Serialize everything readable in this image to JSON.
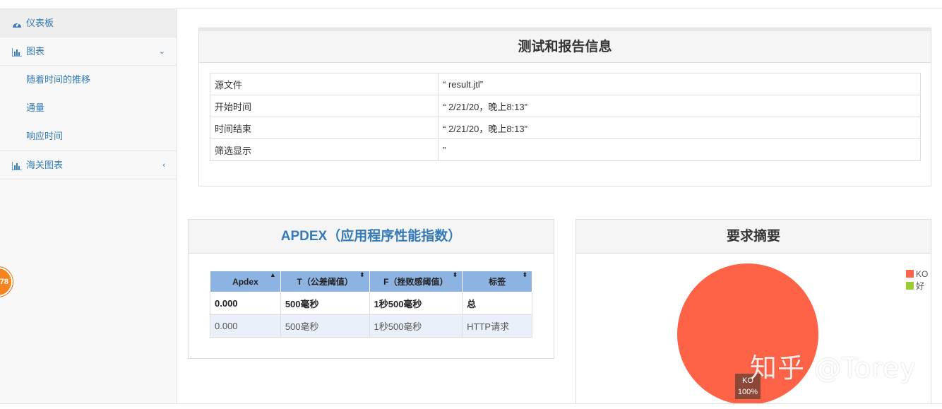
{
  "sidebar": {
    "items": [
      {
        "label": "仪表板",
        "icon": "dashboard-icon"
      },
      {
        "label": "图表",
        "icon": "bar-chart-icon",
        "arrow": "chevron-down"
      },
      {
        "label": "海关图表",
        "icon": "bar-chart-icon",
        "arrow": "chevron-left"
      }
    ],
    "subitems": [
      {
        "label": "随着时间的推移"
      },
      {
        "label": "通量"
      },
      {
        "label": "响应时间"
      }
    ],
    "badge": "78"
  },
  "info_panel": {
    "title": "测试和报告信息",
    "rows": [
      {
        "key": "源文件",
        "value": "“ result.jtl”"
      },
      {
        "key": "开始时间",
        "value": "“ 2/21/20，晚上8:13”"
      },
      {
        "key": "时间结束",
        "value": "“ 2/21/20，晚上8:13”"
      },
      {
        "key": "筛选显示",
        "value": "”"
      }
    ]
  },
  "apdex_panel": {
    "title": "APDEX（应用程序性能指数）",
    "headers": [
      "Apdex",
      "T（公差阈值）",
      "F（挫败感阈值）",
      "标签"
    ],
    "sort_icons": [
      "▲",
      "⬍",
      "⬍",
      "⬍"
    ],
    "rows": [
      [
        "0.000",
        "500毫秒",
        "1秒500毫秒",
        "总"
      ],
      [
        "0.000",
        "500毫秒",
        "1秒500毫秒",
        "HTTP请求"
      ]
    ]
  },
  "summary_panel": {
    "title": "要求摘要",
    "legend": [
      {
        "label": "KO",
        "color": "#ff6347"
      },
      {
        "label": "好",
        "color": "#9acd32"
      }
    ],
    "slice_label": "KO",
    "slice_percent": "100%"
  },
  "chart_data": {
    "type": "pie",
    "title": "要求摘要",
    "categories": [
      "KO",
      "好"
    ],
    "values": [
      100,
      0
    ],
    "legend_position": "top-right"
  },
  "watermark": "知乎 @Torey"
}
